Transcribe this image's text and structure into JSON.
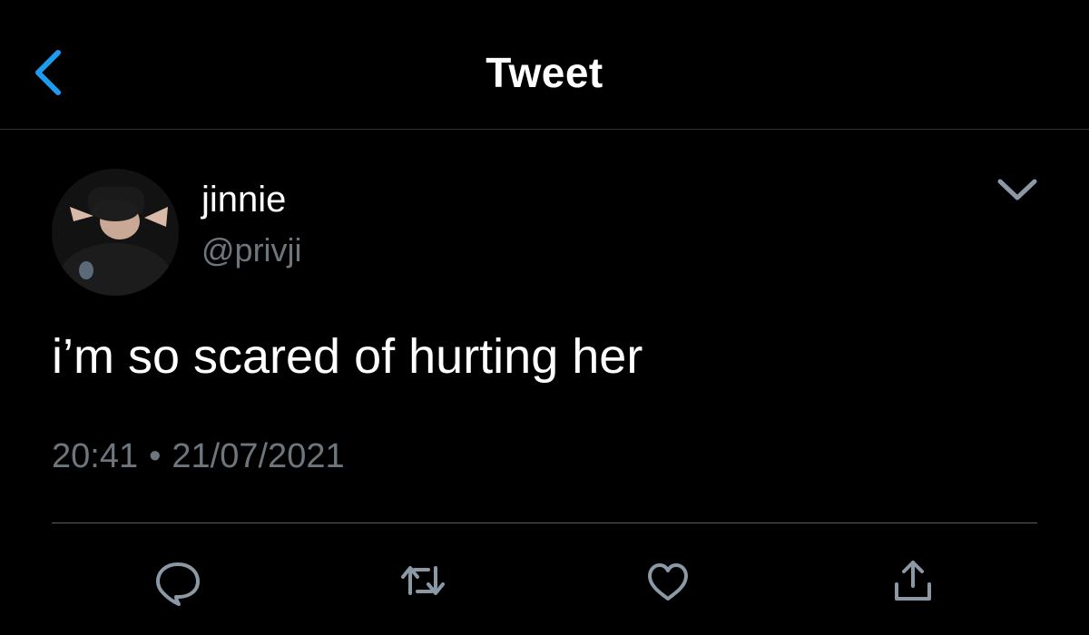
{
  "header": {
    "title": "Tweet",
    "back_icon": "chevron-left-icon",
    "accent_color": "#1d9bf0"
  },
  "tweet": {
    "author": {
      "display_name": "jinnie",
      "handle": "@privji"
    },
    "text": "i’m so scared of hurting her",
    "time": "20:41",
    "separator": "•",
    "date": "21/07/2021",
    "more_icon": "chevron-down-icon"
  },
  "actions": [
    {
      "name": "reply",
      "icon": "speech-bubble-icon"
    },
    {
      "name": "retweet",
      "icon": "retweet-arrows-icon"
    },
    {
      "name": "like",
      "icon": "heart-icon"
    },
    {
      "name": "share",
      "icon": "share-upload-icon"
    }
  ],
  "colors": {
    "background": "#000000",
    "text": "#ffffff",
    "secondary_text": "#6e767d",
    "divider": "#2f3336",
    "icon": "#8b98a5"
  }
}
